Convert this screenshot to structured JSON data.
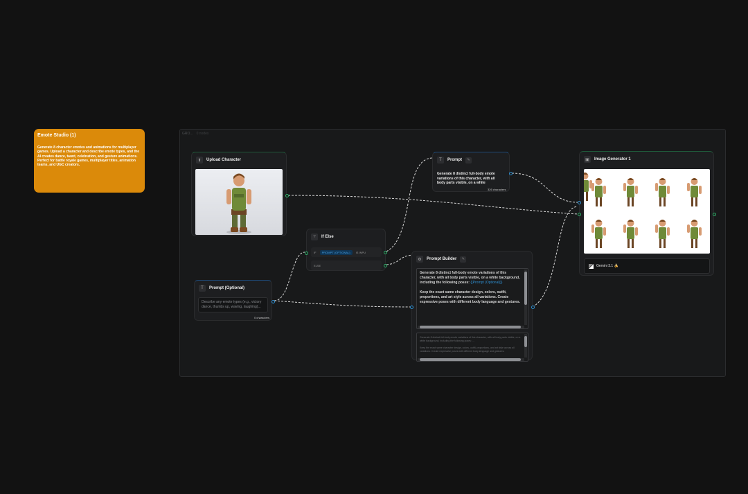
{
  "note": {
    "title": "Emote  Studio (1)",
    "body": "Generate 8 character emotes and animations for multiplayer games. Upload a character and describe emote types, and the AI creates dance, taunt, celebration, and gesture animations. Perfect for battle royale games, multiplayer titles, animation teams, and UGC creators."
  },
  "group": {
    "title": "GRO...",
    "subtitle": "0 nodes"
  },
  "upload_node": {
    "title": "Upload Character"
  },
  "prompt_optional": {
    "title": "Prompt (Optional)",
    "placeholder": "Describe any emote types (e.g., victory dance, thumbs up, waving, laughing)...",
    "char_count": "0 characters"
  },
  "if_else": {
    "title": "If Else",
    "if_label": "IF",
    "condition_tag": "PROMPT (OPTIONAL)",
    "condition_suffix": "IS INPU",
    "else_label": "ELSE"
  },
  "prompt_node": {
    "title": "Prompt",
    "text": "Generate 8 distinct full-body emote variations of this character, with all body parts visible, on a white",
    "char_count": "326 characters"
  },
  "prompt_builder": {
    "title": "Prompt Builder",
    "text_part1": "Generate 8 distinct full-body emote variations of this character, with all body parts visible, on a white background, including the following poses: ",
    "variable": "{{Prompt (Optional)}}",
    "text_part2": "Keep the exact same character design, colors, outfit, proportions, and art style across all variations. Create expressive poses with different body language and gestures.",
    "preview_part1": "Generate 8 distinct full-body emote variations of this character, with all body parts visible, on a white background, including the following poses: ...",
    "preview_part2": "Keep the exact same character design, colors, outfit, proportions, and art style across all variations. Create expressive poses with different body language and gestures."
  },
  "image_generator": {
    "title": "Image Generator 1",
    "model": "Gemini 3.1 🍌"
  },
  "colors": {
    "note_bg": "#db8a0a",
    "port_green": "#2fb36a",
    "port_blue": "#2e8fd1",
    "canvas_bg": "#121212"
  }
}
